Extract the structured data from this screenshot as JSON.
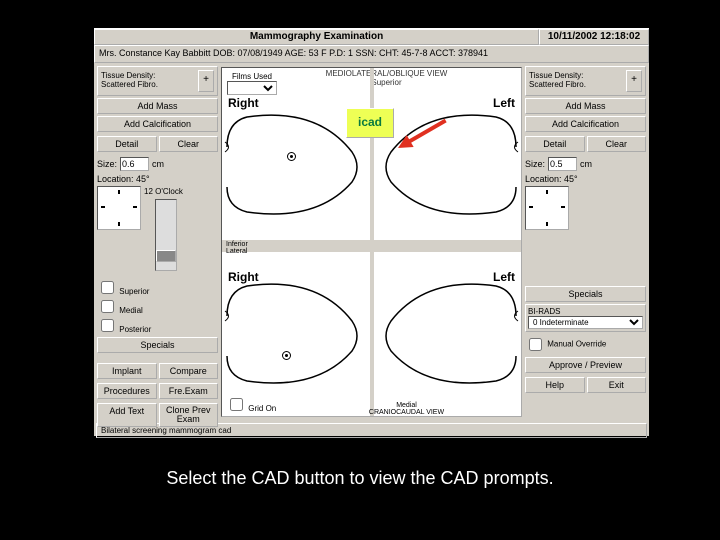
{
  "header": {
    "title": "Mammography Examination",
    "datetime": "10/11/2002 12:18:02"
  },
  "patient": {
    "summary": "Mrs. Constance Kay Babbitt   DOB: 07/08/1949   AGE: 53   F   P.D: 1   SSN:    CHT: 45-7-8   ACCT: 378941"
  },
  "left_panel": {
    "tissue_label": "Tissue Density:\nScattered Fibro.",
    "add_mass": "Add Mass",
    "add_calc": "Add Calcification",
    "detail": "Detail",
    "clear": "Clear",
    "size_label": "Size:",
    "size_value": "0.6",
    "size_unit": "cm",
    "loc_label": "Location: 45°",
    "twelve": "12 O'Clock",
    "superior": "Superior",
    "medial": "Medial",
    "posterior": "Posterior",
    "specials": "Specials",
    "implant": "Implant",
    "compare": "Compare",
    "procedures": "Procedures",
    "freexam": "Fre.Exam",
    "addtext": "Add Text",
    "cloneprev": "Clone Prev\nExam"
  },
  "right_panel": {
    "tissue_label": "Tissue Density:\nScattered Fibro.",
    "add_mass": "Add Mass",
    "add_calc": "Add Calcification",
    "detail": "Detail",
    "clear": "Clear",
    "size_label": "Size:",
    "size_value": "0.5",
    "size_unit": "cm",
    "loc_label": "Location: 45°",
    "specials": "Specials",
    "birads_label": "BI-RADS",
    "birads_value": "0 Indeterminate",
    "manual_override": "Manual Override",
    "approve": "Approve / Preview",
    "help": "Help",
    "exit": "Exit"
  },
  "center": {
    "films_used": "Films Used",
    "mlo_view": "MEDIOLATERAL/OBLIQUE VIEW",
    "superior": "Superior",
    "inferior": "Inferior",
    "lateral": "Lateral",
    "medial": "Medial",
    "cc_view": "CRANIOCAUDAL VIEW",
    "right": "Right",
    "left": "Left",
    "icad": "icad",
    "grid_on": "Grid On"
  },
  "footer": {
    "text": "Bilateral screening mammogram cad"
  },
  "caption": "Select the CAD button to view the CAD prompts."
}
